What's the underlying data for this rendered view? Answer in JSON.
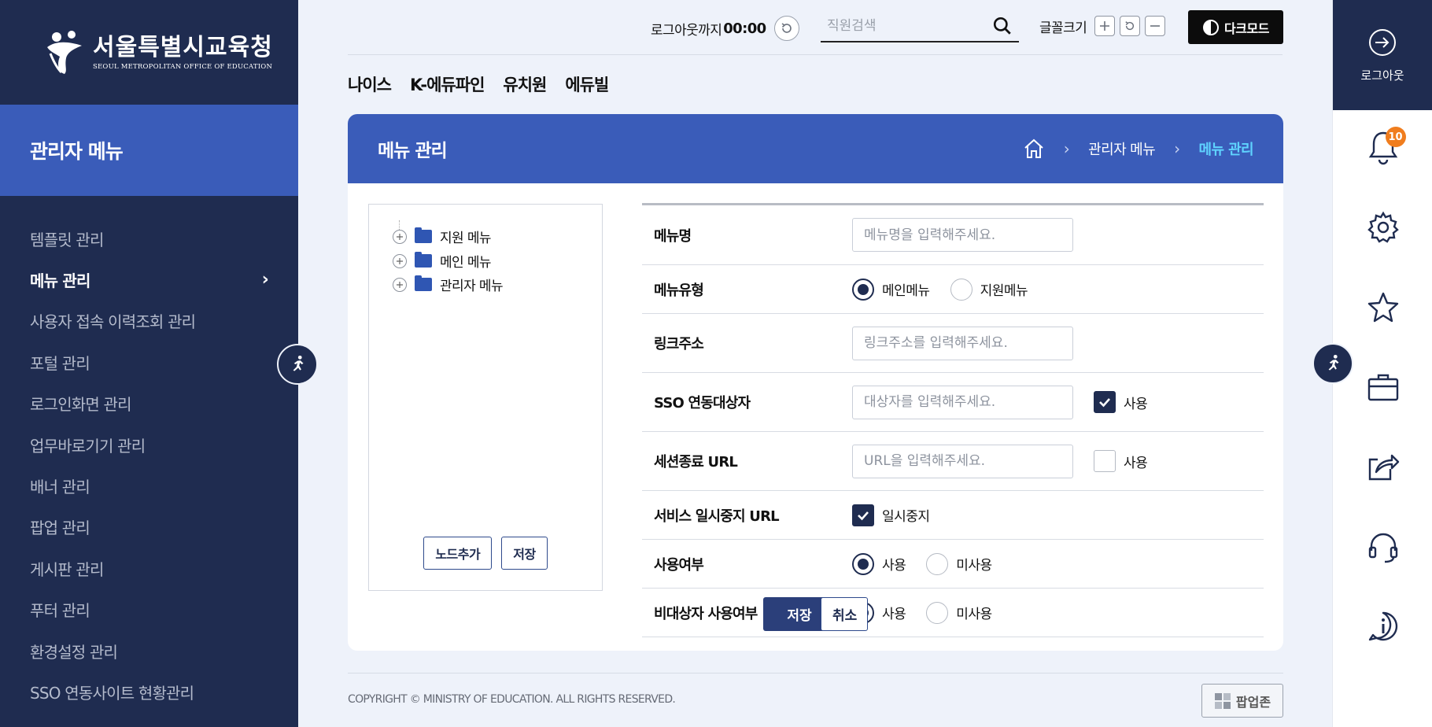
{
  "brand": {
    "name_ko": "서울특별시교육청",
    "name_en": "SEOUL METROPOLITAN OFFICE OF EDUCATION"
  },
  "sidebar": {
    "title": "관리자 메뉴",
    "items": [
      {
        "label": "템플릿 관리",
        "active": false
      },
      {
        "label": "메뉴 관리",
        "active": true
      },
      {
        "label": "사용자 접속 이력조회 관리",
        "active": false
      },
      {
        "label": "포털 관리",
        "active": false
      },
      {
        "label": "로그인화면 관리",
        "active": false
      },
      {
        "label": "업무바로기기 관리",
        "active": false
      },
      {
        "label": "배너 관리",
        "active": false
      },
      {
        "label": "팝업 관리",
        "active": false
      },
      {
        "label": "게시판 관리",
        "active": false
      },
      {
        "label": "푸터 관리",
        "active": false
      },
      {
        "label": "환경설정 관리",
        "active": false
      },
      {
        "label": "SSO 연동사이트 현황관리",
        "active": false
      }
    ]
  },
  "topbar": {
    "timer_label": "로그아웃까지",
    "timer_value": "00:00",
    "search_placeholder": "직원검색",
    "font_size_label": "글꼴크기",
    "dark_mode_label": "다크모드"
  },
  "tabs": [
    "나이스",
    "K-에듀파인",
    "유치원",
    "에듀빌"
  ],
  "panel": {
    "title": "메뉴 관리",
    "breadcrumb": [
      "관리자 메뉴",
      "메뉴 관리"
    ]
  },
  "tree": {
    "nodes": [
      "지원 메뉴",
      "메인 메뉴",
      "관리자 메뉴"
    ],
    "add_node_label": "노드추가",
    "save_label": "저장"
  },
  "form": {
    "menu_name": {
      "label": "메뉴명",
      "placeholder": "메뉴명을 입력해주세요."
    },
    "menu_type": {
      "label": "메뉴유형",
      "options": [
        "메인메뉴",
        "지원메뉴"
      ],
      "selected": "메인메뉴"
    },
    "link": {
      "label": "링크주소",
      "placeholder": "링크주소를 입력해주세요."
    },
    "sso": {
      "label": "SSO 연동대상자",
      "placeholder": "대상자를 입력해주세요.",
      "check_label": "사용",
      "checked": true
    },
    "session_url": {
      "label": "세션종료 URL",
      "placeholder": "URL을 입력해주세요.",
      "check_label": "사용",
      "checked": false
    },
    "pause_url": {
      "label": "서비스 일시중지 URL",
      "check_label": "일시중지",
      "checked": true
    },
    "use": {
      "label": "사용여부",
      "options": [
        "사용",
        "미사용"
      ],
      "selected": "사용"
    },
    "non_target": {
      "label": "비대상자 사용여부",
      "options": [
        "사용",
        "미사용"
      ],
      "selected": "사용"
    },
    "save_label": "저장",
    "cancel_label": "취소"
  },
  "rail": {
    "logout_label": "로그아웃",
    "notification_count": "10"
  },
  "footer": {
    "copyright": "COPYRIGHT © MINISTRY OF EDUCATION. ALL RIGHTS RESERVED.",
    "popup_label": "팝업존"
  },
  "colors": {
    "navy": "#1f2c50",
    "blue": "#3a5cb9",
    "accent_cyan": "#5fd3ff",
    "badge_orange": "#f07d1e"
  }
}
